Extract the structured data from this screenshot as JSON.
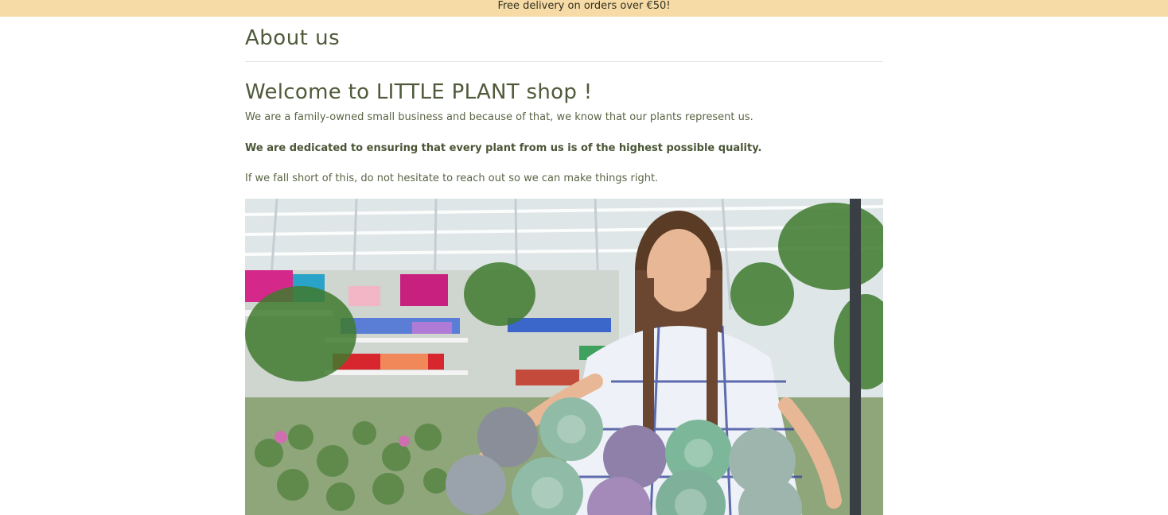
{
  "promo": {
    "text": "Free delivery on orders over €50!"
  },
  "page": {
    "title": "About us"
  },
  "about": {
    "heading": "Welcome to LITTLE PLANT shop !",
    "paragraph_1": "We are a family-owned small business and because of that, we know that our plants represent us.",
    "paragraph_2": "We are dedicated to ensuring that every plant from us is of the highest possible quality.",
    "paragraph_3": "If we fall short of this, do not hesitate to reach out so we can make things right."
  },
  "colors": {
    "promo_background": "#f7dba6",
    "heading_text": "#4f5a3a",
    "divider": "#e4e4e4"
  }
}
